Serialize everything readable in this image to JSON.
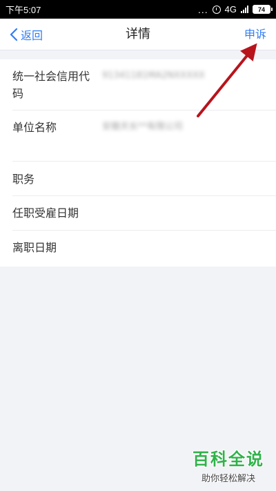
{
  "status_bar": {
    "time": "下午5:07",
    "dots": "...",
    "network": "4G",
    "battery": "74"
  },
  "nav": {
    "back_label": "返回",
    "title": "详情",
    "appeal_label": "申诉"
  },
  "details": {
    "rows": [
      {
        "label": "统一社会信用代码",
        "value": "91341181MA2NXXXXX"
      },
      {
        "label": "单位名称",
        "value": "安徽天长**有限公司"
      },
      {
        "label": "职务",
        "value": ""
      },
      {
        "label": "任职受雇日期",
        "value": ""
      },
      {
        "label": "离职日期",
        "value": ""
      }
    ]
  },
  "annotation": {
    "arrow_color": "#b8141c"
  },
  "watermark": {
    "title": "百科全说",
    "subtitle": "助你轻松解决",
    "color": "#2fb24a"
  },
  "colors": {
    "accent": "#2f7cf6",
    "background": "#f2f3f7"
  }
}
